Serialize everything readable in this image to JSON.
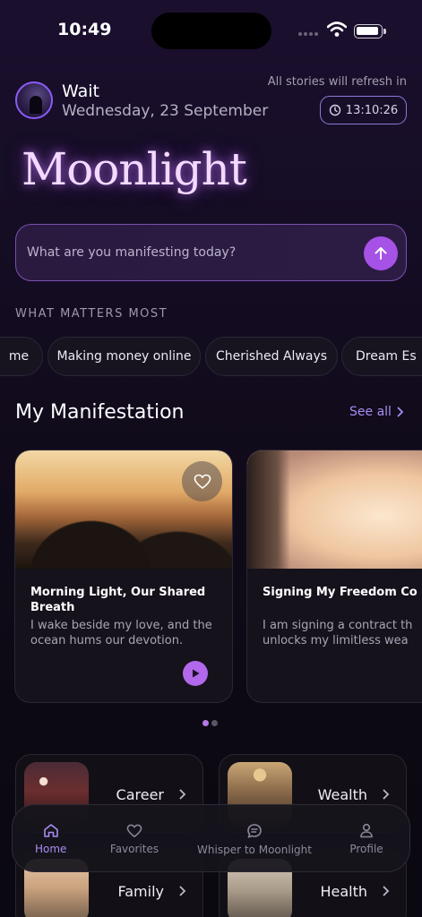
{
  "status_bar": {
    "time": "10:49"
  },
  "header": {
    "username": "Wait",
    "date": "Wednesday, 23 September",
    "refresh_text": "All stories will refresh in",
    "countdown": "13:10:26"
  },
  "brand": {
    "logo_text": "Moonlight",
    "accent": "#a652e6"
  },
  "search": {
    "placeholder": "What are you manifesting today?"
  },
  "what_matters": {
    "label": "WHAT MATTERS MOST",
    "chips": [
      "me",
      "Making money online",
      "Cherished Always",
      "Dream Es"
    ]
  },
  "manifestation": {
    "title": "My Manifestation",
    "see_all": "See all",
    "cards": [
      {
        "title": "Morning Light, Our Shared Breath",
        "description": "I wake beside my love, and the ocean hums our devotion."
      },
      {
        "title": "Signing My Freedom Co",
        "description": "I am signing a contract th unlocks my limitless wea"
      }
    ]
  },
  "categories": [
    {
      "label": "Career",
      "icon": "concert-thumbnail"
    },
    {
      "label": "Wealth",
      "icon": "villa-thumbnail"
    },
    {
      "label": "Family",
      "icon": "family-beach-thumbnail"
    },
    {
      "label": "Health",
      "icon": "meditation-thumbnail"
    }
  ],
  "tab_bar": {
    "tabs": [
      {
        "label": "Home",
        "icon": "home-icon",
        "active": true
      },
      {
        "label": "Favorites",
        "icon": "heart-icon",
        "active": false
      },
      {
        "label": "Whisper to Moonlight",
        "icon": "chat-icon",
        "active": false
      },
      {
        "label": "Profile",
        "icon": "user-icon",
        "active": false
      }
    ]
  }
}
